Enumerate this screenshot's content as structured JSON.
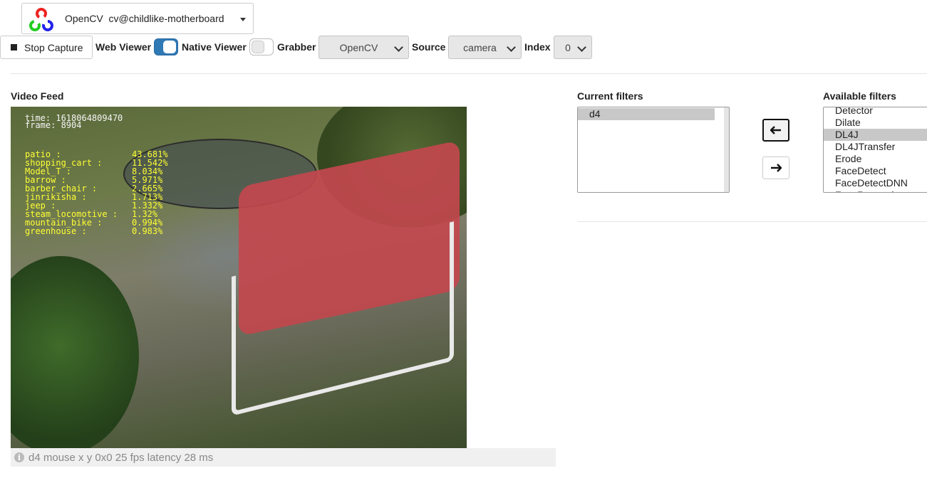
{
  "service": {
    "name": "OpenCV",
    "address": "cv@childlike-motherboard"
  },
  "toolbar": {
    "stop_label": "Stop Capture",
    "web_viewer_label": "Web Viewer",
    "web_viewer_on": true,
    "native_viewer_label": "Native Viewer",
    "native_viewer_on": false,
    "grabber_label": "Grabber",
    "grabber_value": "OpenCV",
    "source_label": "Source",
    "source_value": "camera",
    "index_label": "Index",
    "index_value": "0"
  },
  "video": {
    "title": "Video Feed",
    "time_line": "time: 1618064809470",
    "frame_line": "frame: 8904",
    "classifications": [
      {
        "label": "patio",
        "value": "43.681%"
      },
      {
        "label": "shopping_cart",
        "value": "11.542%"
      },
      {
        "label": "Model_T",
        "value": "8.034%"
      },
      {
        "label": "barrow",
        "value": "5.971%"
      },
      {
        "label": "barber_chair",
        "value": "2.665%"
      },
      {
        "label": "jinrikisha",
        "value": "1.713%"
      },
      {
        "label": "jeep",
        "value": "1.332%"
      },
      {
        "label": "steam_locomotive",
        "value": "1.32%"
      },
      {
        "label": "mountain_bike",
        "value": "0.994%"
      },
      {
        "label": "greenhouse",
        "value": "0.983%"
      }
    ],
    "status": "d4 mouse x y 0x0 25 fps latency 28 ms"
  },
  "filters": {
    "current_title": "Current filters",
    "current": [
      "d4"
    ],
    "available_title": "Available filters",
    "available": [
      "Detector",
      "Dilate",
      "DL4J",
      "DL4JTransfer",
      "Erode",
      "FaceDetect",
      "FaceDetectDNN",
      "FaceRecognizer"
    ],
    "available_selected": "DL4J",
    "move_left_icon": "arrow-left-icon",
    "move_right_icon": "arrow-right-icon"
  }
}
